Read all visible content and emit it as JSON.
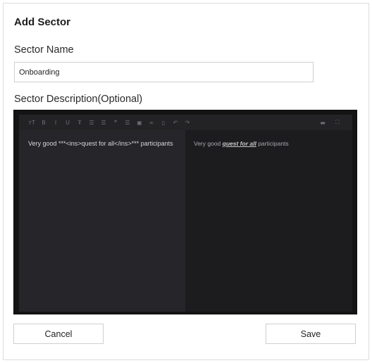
{
  "dialog": {
    "title": "Add Sector",
    "name_label": "Sector Name",
    "name_value": "Onboarding",
    "description_label": "Sector Description(Optional)"
  },
  "editor": {
    "toolbar": [
      {
        "icon": "heading-icon",
        "glyph": "тТ"
      },
      {
        "icon": "bold-icon",
        "glyph": "B"
      },
      {
        "icon": "italic-icon",
        "glyph": "I"
      },
      {
        "icon": "underline-icon",
        "glyph": "U"
      },
      {
        "icon": "strikethrough-icon",
        "glyph": "Ŧ"
      },
      {
        "icon": "unordered-list-icon",
        "glyph": "☰"
      },
      {
        "icon": "ordered-list-icon",
        "glyph": "☰"
      },
      {
        "icon": "quote-icon",
        "glyph": "❞"
      },
      {
        "icon": "checklist-icon",
        "glyph": "☰"
      },
      {
        "icon": "image-icon",
        "glyph": "▣"
      },
      {
        "icon": "link-icon",
        "glyph": "∞"
      },
      {
        "icon": "delete-icon",
        "glyph": "▯"
      },
      {
        "icon": "undo-icon",
        "glyph": "↶"
      },
      {
        "icon": "redo-icon",
        "glyph": "↷"
      }
    ],
    "toolbar_right": [
      {
        "icon": "preview-toggle-icon",
        "glyph": "▬"
      },
      {
        "icon": "fullscreen-icon",
        "glyph": "⛶"
      }
    ],
    "source_text": "Very good ***<ins>quest for all</ins>*** participants",
    "preview": {
      "before": "Very good ",
      "emphasis": "quest for all",
      "after": " participants"
    }
  },
  "buttons": {
    "cancel": "Cancel",
    "save": "Save"
  },
  "colors": {
    "editor_bg": "#1d1d20",
    "editor_source_pane": "#26262a",
    "editor_preview_pane": "#1c1c1f",
    "border": "#cfcfcf"
  }
}
